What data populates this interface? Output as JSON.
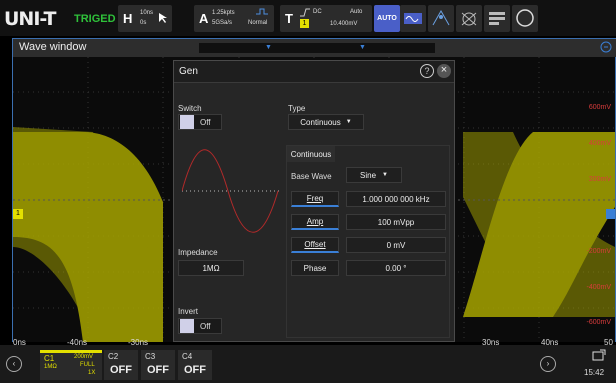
{
  "topbar": {
    "logo": "UNI-T",
    "trig": "TRIGED",
    "h_label": "H",
    "h_scale": "10ns",
    "h_pos": "0s",
    "a_label": "A",
    "a_pts": "1.25kpts",
    "a_rate": "5GSa/s",
    "a_mode": "Normal",
    "t_label": "T",
    "t_coupling": "DC",
    "t_mode": "Auto",
    "t_channel": "1",
    "t_level": "10.400mV",
    "auto_label": "AUTO"
  },
  "wave": {
    "title": "Wave window",
    "y_labels": [
      "600mV",
      "400mV",
      "200mV",
      "-200mV",
      "-400mV",
      "-600mV"
    ],
    "x_labels": [
      "0ns",
      "-40ns",
      "-30ns",
      "30ns",
      "40ns",
      "50"
    ],
    "channel_marker": "1"
  },
  "dialog": {
    "title": "Gen",
    "help": "?",
    "close": "×",
    "switch_label": "Switch",
    "switch_value": "Off",
    "type_label": "Type",
    "type_value": "Continuous",
    "tab": "Continuous",
    "base_wave_label": "Base Wave",
    "base_wave_value": "Sine",
    "freq_label": "Freq",
    "freq_value": "1.000 000 000 kHz",
    "amp_label": "Amp",
    "amp_value": "100 mVpp",
    "offset_label": "Offset",
    "offset_value": "0 mV",
    "phase_label": "Phase",
    "phase_value": "0.00 °",
    "impedance_label": "Impedance",
    "impedance_value": "1MΩ",
    "invert_label": "Invert",
    "invert_value": "Off"
  },
  "bottom": {
    "c1": "C1",
    "c1_scale": "200mV",
    "c1_imp": "1MΩ",
    "c1_bw": "FULL",
    "c1_probe": "1X",
    "c2": "C2",
    "c3": "C3",
    "c4": "C4",
    "off": "OFF",
    "time": "15:42"
  },
  "colors": {
    "accent": "#3a7fd6",
    "ch1": "#e3e000",
    "scale": "#d93c3c"
  }
}
